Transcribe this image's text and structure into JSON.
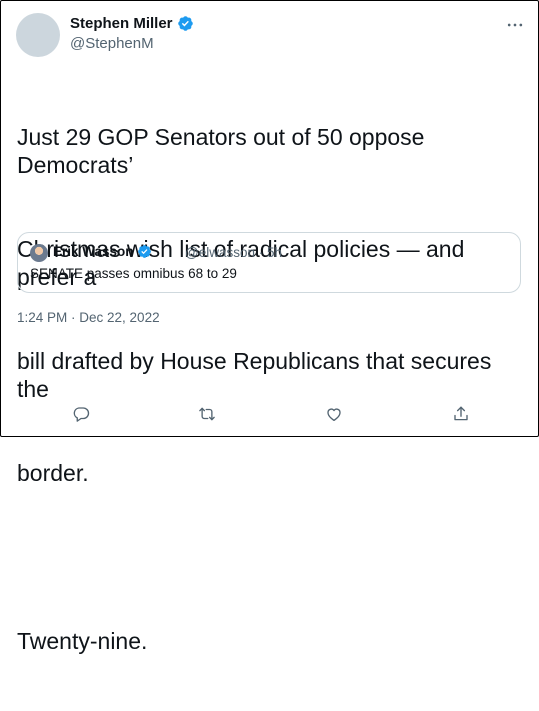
{
  "author": {
    "name": "Stephen Miller",
    "handle": "@StephenM"
  },
  "tweet": {
    "lines": [
      "Just 29 GOP Senators out of 50 oppose Democrats’",
      "Christmas wish list of radical policies — and prefer a",
      "bill drafted by House Republicans that secures the",
      "border."
    ],
    "closing": "Twenty-nine.",
    "timestamp": "1:24 PM · Dec 22, 2022"
  },
  "quote": {
    "name": "Erik Wasson",
    "handle_time": "@elwasson · 5h",
    "text": "SENATE passes omnibus 68 to 29"
  },
  "icons": {
    "verified": "verified-badge-icon",
    "more": "more-options-icon",
    "reply": "reply-icon",
    "retweet": "retweet-icon",
    "like": "like-icon",
    "share": "share-icon"
  },
  "colors": {
    "verified": "#1d9bf0",
    "secondary_text": "#536471",
    "icon": "#536471"
  }
}
